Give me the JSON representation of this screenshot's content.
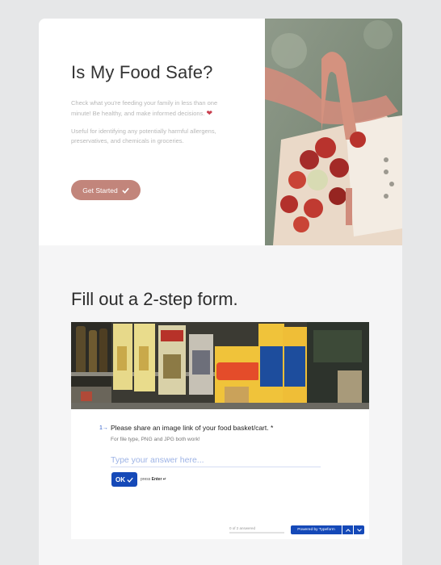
{
  "hero": {
    "title": "Is My Food Safe?",
    "intro": "Check what you're feeding your family in less than one minute! Be healthy, and make informed decisions.",
    "detail": "Useful for identifying any potentially harmful allergens, preservatives, and chemicals in groceries.",
    "cta_label": "Get Started",
    "cta_icon": "check-icon",
    "heart_icon": "heart-icon",
    "accent_color": "#c2857b"
  },
  "form_section": {
    "title": "Fill out a 2-step form.",
    "question_number": "1",
    "question_text": "Please share an image link of your food basket/cart. *",
    "helper_text": "For file type, PNG and JPG both work!",
    "answer_placeholder": "Type your answer here...",
    "ok_label": "OK",
    "press_label": "press",
    "enter_label": "Enter ↵",
    "progress_text": "0 of 2 answered",
    "progress_fraction": 0,
    "powered_label": "Powered by Typeform",
    "brand_color": "#1549b8"
  }
}
